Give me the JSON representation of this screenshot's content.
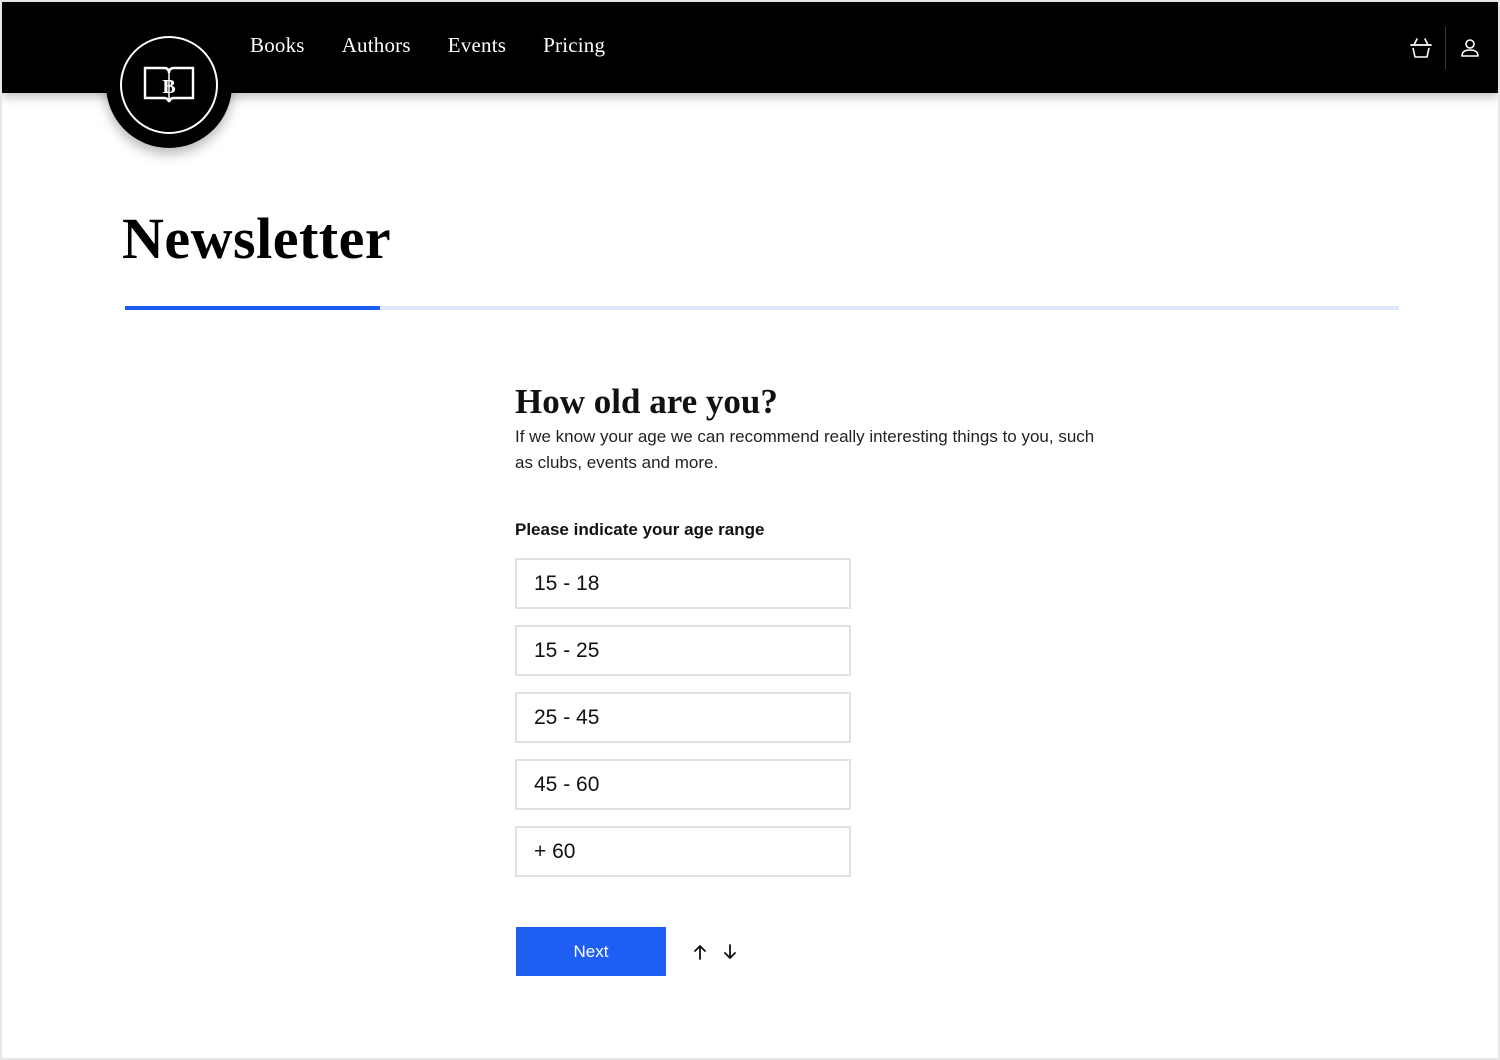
{
  "header": {
    "logo_letter": "B",
    "nav": [
      "Books",
      "Authors",
      "Events",
      "Pricing"
    ],
    "icons": [
      "basket-icon",
      "user-icon"
    ]
  },
  "page": {
    "title": "Newsletter",
    "progress_percent": 20
  },
  "form": {
    "question": "How old are you?",
    "description": "If we know your age we can recommend really interesting things to you, such as clubs, events and more.",
    "field_label": "Please indicate your age range",
    "options": [
      "15 - 18",
      "15 - 25",
      "25 - 45",
      "45 - 60",
      "+ 60"
    ],
    "next_label": "Next"
  },
  "colors": {
    "accent": "#1f5ef2",
    "progress_track": "#dfe8fb",
    "header_bg": "#000000"
  }
}
